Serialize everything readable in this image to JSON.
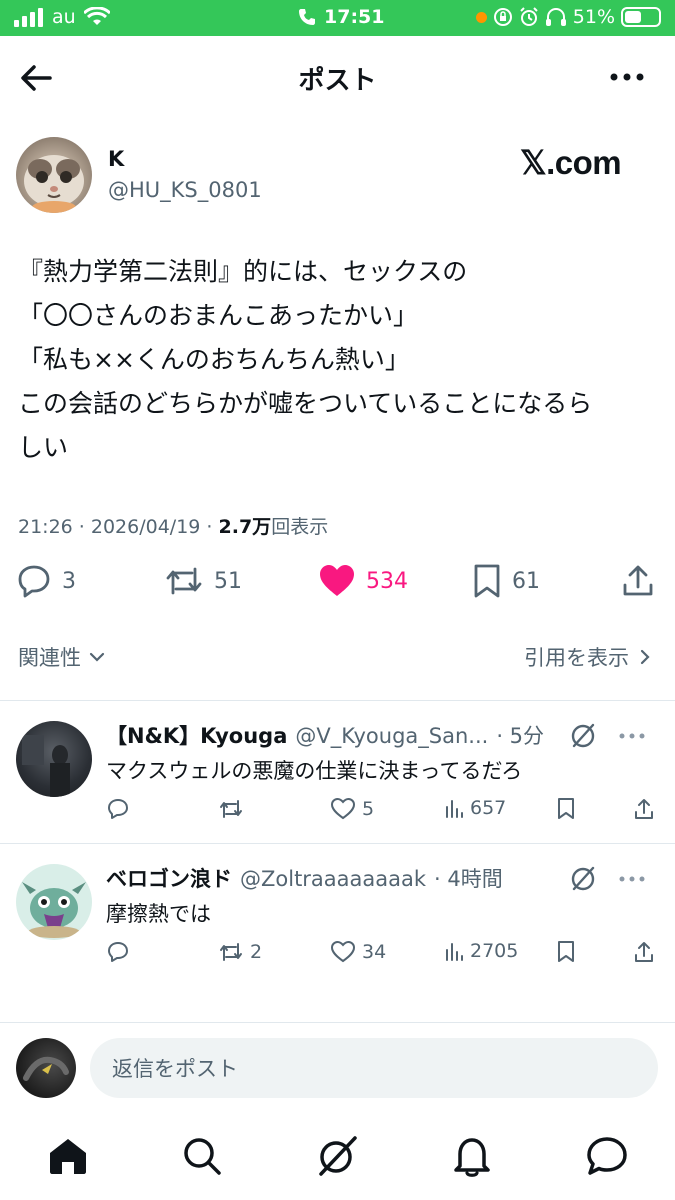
{
  "status_bar": {
    "carrier": "au",
    "time": "17:51",
    "battery_percent": "51%",
    "battery_level": 0.51,
    "background_color": "#34c759"
  },
  "header": {
    "title": "ポスト",
    "back_icon": "arrow-left-icon",
    "more_icon": "more-horizontal-icon"
  },
  "post": {
    "author_name": "K",
    "author_handle": "@HU_KS_0801",
    "brand_text": "𝕏.com",
    "text_lines": [
      "『熱力学第二法則』的には、セックスの",
      "「〇〇さんのおまんこあったかい」",
      "「私も××くんのおちんちん熱い」",
      "この会話のどちらかが嘘をついていることになるら",
      "しい"
    ],
    "timestamp": "21:26 · 2026/04/19 · ",
    "views_count": "2.7万",
    "views_label": "回表示",
    "actions": {
      "replies": "3",
      "reposts": "51",
      "likes": "534",
      "bookmarks": "61"
    },
    "like_color": "#f91880"
  },
  "sort": {
    "label": "関連性",
    "quotes_link": "引用を表示"
  },
  "replies": [
    {
      "name": "【N&K】Kyouga",
      "handle": "@V_Kyouga_San...",
      "time": "· 5分",
      "text": "マクスウェルの悪魔の仕業に決まってるだろ",
      "reply_count": "",
      "repost_count": "",
      "like_count": "5",
      "view_count": "657"
    },
    {
      "name": "ベロゴン浪ド",
      "handle": "@Zoltraaaaaaaak",
      "time": "· 4時間",
      "text": "摩擦熱では",
      "reply_count": "",
      "repost_count": "2",
      "like_count": "34",
      "view_count": "2705"
    }
  ],
  "composer": {
    "placeholder": "返信をポスト"
  },
  "bottom_nav": [
    "home-icon",
    "search-icon",
    "grok-icon",
    "notifications-icon",
    "messages-icon"
  ]
}
